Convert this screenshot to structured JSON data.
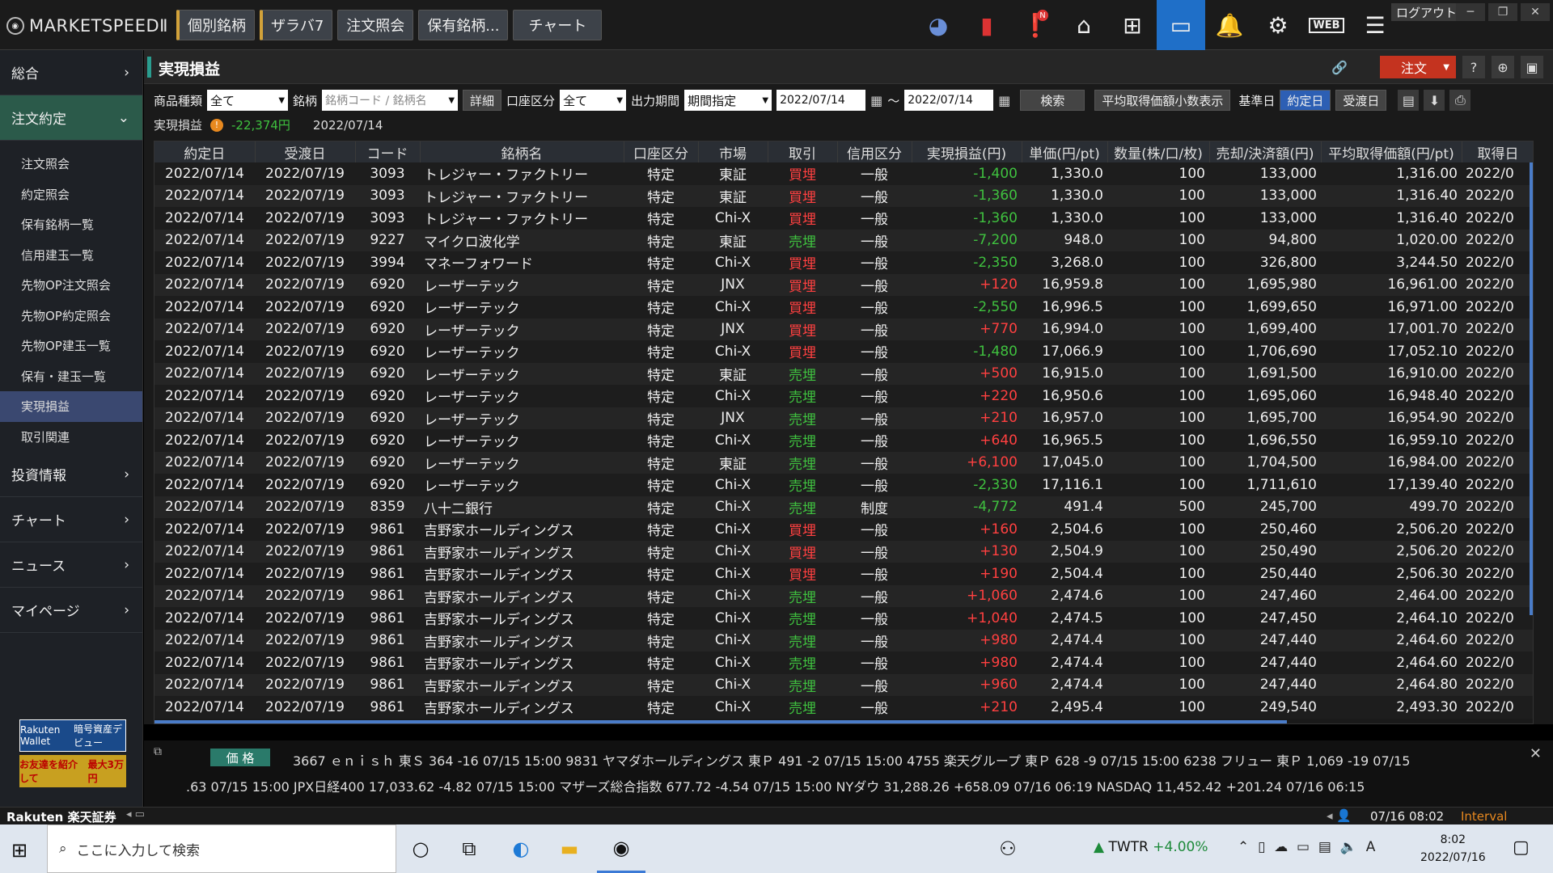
{
  "app": {
    "logo": "MARKETSPEEDⅡ",
    "logout": "ログアウト"
  },
  "topnav": [
    "個別銘柄",
    "ザラバ7",
    "注文照会",
    "保有銘柄...",
    "チャート"
  ],
  "sidebar": {
    "main_top": [
      "総合",
      "注文約定"
    ],
    "sub": [
      "注文照会",
      "約定照会",
      "保有銘柄一覧",
      "信用建玉一覧",
      "先物OP注文照会",
      "先物OP約定照会",
      "先物OP建玉一覧",
      "保有・建玉一覧",
      "実現損益",
      "取引関連"
    ],
    "main_bottom": [
      "投資情報",
      "チャート",
      "ニュース",
      "マイページ"
    ],
    "promo": {
      "wallet": "Rakuten Wallet",
      "crypto": "暗号資産デビュー",
      "friend": "お友達を紹介して",
      "amount": "最大3万円"
    }
  },
  "page": {
    "title": "実現損益",
    "order_button": "注文"
  },
  "filters": {
    "product_label": "商品種類",
    "product_value": "全て",
    "brand_label": "銘柄",
    "brand_placeholder": "銘柄コード / 銘柄名",
    "detail": "詳細",
    "account_label": "口座区分",
    "account_value": "全て",
    "period_label": "出力期間",
    "period_value": "期間指定",
    "date_from": "2022/07/14",
    "tilde": "～",
    "date_to": "2022/07/14",
    "search": "検索",
    "decimal_toggle": "平均取得価額小数表示",
    "base_date_label": "基準日",
    "base_trade": "約定日",
    "base_settle": "受渡日"
  },
  "summary": {
    "label": "実現損益",
    "value": "-22,374円",
    "date": "2022/07/14"
  },
  "table": {
    "headers": [
      "約定日",
      "受渡日",
      "コード",
      "銘柄名",
      "口座区分",
      "市場",
      "取引",
      "信用区分",
      "実現損益(円)",
      "単価(円/pt)",
      "数量(株/口/枚)",
      "売却/決済額(円)",
      "平均取得価額(円/pt)",
      "取得日"
    ],
    "rows": [
      [
        "2022/07/14",
        "2022/07/19",
        "3093",
        "トレジャー・ファクトリー",
        "特定",
        "東証",
        "買埋",
        "一般",
        "-1,400",
        "1,330.0",
        "100",
        "133,000",
        "1,316.00",
        "2022/0"
      ],
      [
        "2022/07/14",
        "2022/07/19",
        "3093",
        "トレジャー・ファクトリー",
        "特定",
        "東証",
        "買埋",
        "一般",
        "-1,360",
        "1,330.0",
        "100",
        "133,000",
        "1,316.40",
        "2022/0"
      ],
      [
        "2022/07/14",
        "2022/07/19",
        "3093",
        "トレジャー・ファクトリー",
        "特定",
        "Chi-X",
        "買埋",
        "一般",
        "-1,360",
        "1,330.0",
        "100",
        "133,000",
        "1,316.40",
        "2022/0"
      ],
      [
        "2022/07/14",
        "2022/07/19",
        "9227",
        "マイクロ波化学",
        "特定",
        "東証",
        "売埋",
        "一般",
        "-7,200",
        "948.0",
        "100",
        "94,800",
        "1,020.00",
        "2022/0"
      ],
      [
        "2022/07/14",
        "2022/07/19",
        "3994",
        "マネーフォワード",
        "特定",
        "Chi-X",
        "買埋",
        "一般",
        "-2,350",
        "3,268.0",
        "100",
        "326,800",
        "3,244.50",
        "2022/0"
      ],
      [
        "2022/07/14",
        "2022/07/19",
        "6920",
        "レーザーテック",
        "特定",
        "JNX",
        "買埋",
        "一般",
        "+120",
        "16,959.8",
        "100",
        "1,695,980",
        "16,961.00",
        "2022/0"
      ],
      [
        "2022/07/14",
        "2022/07/19",
        "6920",
        "レーザーテック",
        "特定",
        "Chi-X",
        "買埋",
        "一般",
        "-2,550",
        "16,996.5",
        "100",
        "1,699,650",
        "16,971.00",
        "2022/0"
      ],
      [
        "2022/07/14",
        "2022/07/19",
        "6920",
        "レーザーテック",
        "特定",
        "JNX",
        "買埋",
        "一般",
        "+770",
        "16,994.0",
        "100",
        "1,699,400",
        "17,001.70",
        "2022/0"
      ],
      [
        "2022/07/14",
        "2022/07/19",
        "6920",
        "レーザーテック",
        "特定",
        "Chi-X",
        "買埋",
        "一般",
        "-1,480",
        "17,066.9",
        "100",
        "1,706,690",
        "17,052.10",
        "2022/0"
      ],
      [
        "2022/07/14",
        "2022/07/19",
        "6920",
        "レーザーテック",
        "特定",
        "東証",
        "売埋",
        "一般",
        "+500",
        "16,915.0",
        "100",
        "1,691,500",
        "16,910.00",
        "2022/0"
      ],
      [
        "2022/07/14",
        "2022/07/19",
        "6920",
        "レーザーテック",
        "特定",
        "Chi-X",
        "売埋",
        "一般",
        "+220",
        "16,950.6",
        "100",
        "1,695,060",
        "16,948.40",
        "2022/0"
      ],
      [
        "2022/07/14",
        "2022/07/19",
        "6920",
        "レーザーテック",
        "特定",
        "JNX",
        "売埋",
        "一般",
        "+210",
        "16,957.0",
        "100",
        "1,695,700",
        "16,954.90",
        "2022/0"
      ],
      [
        "2022/07/14",
        "2022/07/19",
        "6920",
        "レーザーテック",
        "特定",
        "Chi-X",
        "売埋",
        "一般",
        "+640",
        "16,965.5",
        "100",
        "1,696,550",
        "16,959.10",
        "2022/0"
      ],
      [
        "2022/07/14",
        "2022/07/19",
        "6920",
        "レーザーテック",
        "特定",
        "東証",
        "売埋",
        "一般",
        "+6,100",
        "17,045.0",
        "100",
        "1,704,500",
        "16,984.00",
        "2022/0"
      ],
      [
        "2022/07/14",
        "2022/07/19",
        "6920",
        "レーザーテック",
        "特定",
        "Chi-X",
        "売埋",
        "一般",
        "-2,330",
        "17,116.1",
        "100",
        "1,711,610",
        "17,139.40",
        "2022/0"
      ],
      [
        "2022/07/14",
        "2022/07/19",
        "8359",
        "八十二銀行",
        "特定",
        "Chi-X",
        "売埋",
        "制度",
        "-4,772",
        "491.4",
        "500",
        "245,700",
        "499.70",
        "2022/0"
      ],
      [
        "2022/07/14",
        "2022/07/19",
        "9861",
        "吉野家ホールディングス",
        "特定",
        "Chi-X",
        "買埋",
        "一般",
        "+160",
        "2,504.6",
        "100",
        "250,460",
        "2,506.20",
        "2022/0"
      ],
      [
        "2022/07/14",
        "2022/07/19",
        "9861",
        "吉野家ホールディングス",
        "特定",
        "Chi-X",
        "買埋",
        "一般",
        "+130",
        "2,504.9",
        "100",
        "250,490",
        "2,506.20",
        "2022/0"
      ],
      [
        "2022/07/14",
        "2022/07/19",
        "9861",
        "吉野家ホールディングス",
        "特定",
        "Chi-X",
        "買埋",
        "一般",
        "+190",
        "2,504.4",
        "100",
        "250,440",
        "2,506.30",
        "2022/0"
      ],
      [
        "2022/07/14",
        "2022/07/19",
        "9861",
        "吉野家ホールディングス",
        "特定",
        "Chi-X",
        "売埋",
        "一般",
        "+1,060",
        "2,474.6",
        "100",
        "247,460",
        "2,464.00",
        "2022/0"
      ],
      [
        "2022/07/14",
        "2022/07/19",
        "9861",
        "吉野家ホールディングス",
        "特定",
        "Chi-X",
        "売埋",
        "一般",
        "+1,040",
        "2,474.5",
        "100",
        "247,450",
        "2,464.10",
        "2022/0"
      ],
      [
        "2022/07/14",
        "2022/07/19",
        "9861",
        "吉野家ホールディングス",
        "特定",
        "Chi-X",
        "売埋",
        "一般",
        "+980",
        "2,474.4",
        "100",
        "247,440",
        "2,464.60",
        "2022/0"
      ],
      [
        "2022/07/14",
        "2022/07/19",
        "9861",
        "吉野家ホールディングス",
        "特定",
        "Chi-X",
        "売埋",
        "一般",
        "+980",
        "2,474.4",
        "100",
        "247,440",
        "2,464.60",
        "2022/0"
      ],
      [
        "2022/07/14",
        "2022/07/19",
        "9861",
        "吉野家ホールディングス",
        "特定",
        "Chi-X",
        "売埋",
        "一般",
        "+960",
        "2,474.4",
        "100",
        "247,440",
        "2,464.80",
        "2022/0"
      ],
      [
        "2022/07/14",
        "2022/07/19",
        "9861",
        "吉野家ホールディングス",
        "特定",
        "Chi-X",
        "売埋",
        "一般",
        "+210",
        "2,495.4",
        "100",
        "249,540",
        "2,493.30",
        "2022/0"
      ]
    ]
  },
  "ticker": {
    "label": "価 格",
    "line1": "3667 ｅｎｉｓｈ 東Ｓ 364 -16 07/15 15:00    9831 ヤマダホールディングス 東Ｐ 491 -2 07/15 15:00    4755 楽天グループ 東Ｐ 628 -9 07/15 15:00    6238 フリュー 東Ｐ 1,069 -19 07/15",
    "line2": ".63 07/15 15:00    JPX日経400 17,033.62 -4.82 07/15 15:00    マザーズ総合指数 677.72 -4.54 07/15 15:00    NYダウ 31,288.26 +658.09 07/16 06:19    NASDAQ 11,452.42 +201.24 07/16 06:15"
  },
  "status": {
    "brand": "Rakuten 楽天証券",
    "clock": "07/16 08:02",
    "interval": "Interval"
  },
  "taskbar": {
    "search": "ここに入力して検索",
    "twtr": "TWTR",
    "twtr_change": "+4.00%",
    "time": "8:02",
    "date": "2022/07/16",
    "ime": "A"
  },
  "colors": {
    "accent": "#1f6fc8",
    "buy": "#ff4040",
    "sell": "#3fc13f",
    "order": "#c4331f"
  }
}
